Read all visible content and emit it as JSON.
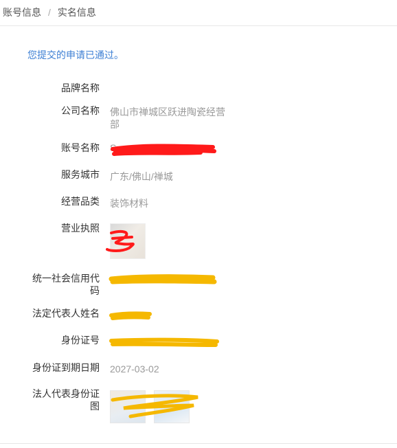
{
  "breadcrumb": {
    "items": [
      "账号信息",
      "实名信息"
    ],
    "separator": "/"
  },
  "notice": "您提交的申请已通过。",
  "fields": {
    "brand": {
      "label": "品牌名称",
      "value": ""
    },
    "company": {
      "label": "公司名称",
      "value": "佛山市禅城区跃进陶瓷经营部"
    },
    "account": {
      "label": "账号名称",
      "value": "S"
    },
    "city": {
      "label": "服务城市",
      "value": "广东/佛山/禅城"
    },
    "category": {
      "label": "经营品类",
      "value": "装饰材料"
    },
    "license": {
      "label": "营业执照"
    },
    "credit_code": {
      "label": "统一社会信用代码",
      "value": ""
    },
    "legal_name": {
      "label": "法定代表人姓名",
      "value": ""
    },
    "id_number": {
      "label": "身份证号",
      "value": ""
    },
    "id_expiry": {
      "label": "身份证到期日期",
      "value": "2027-03-02"
    },
    "id_photos": {
      "label": "法人代表身份证图"
    }
  },
  "colors": {
    "notice": "#3d7fd4",
    "redaction_red": "#ff1a1a",
    "redaction_yellow": "#f5b800"
  }
}
